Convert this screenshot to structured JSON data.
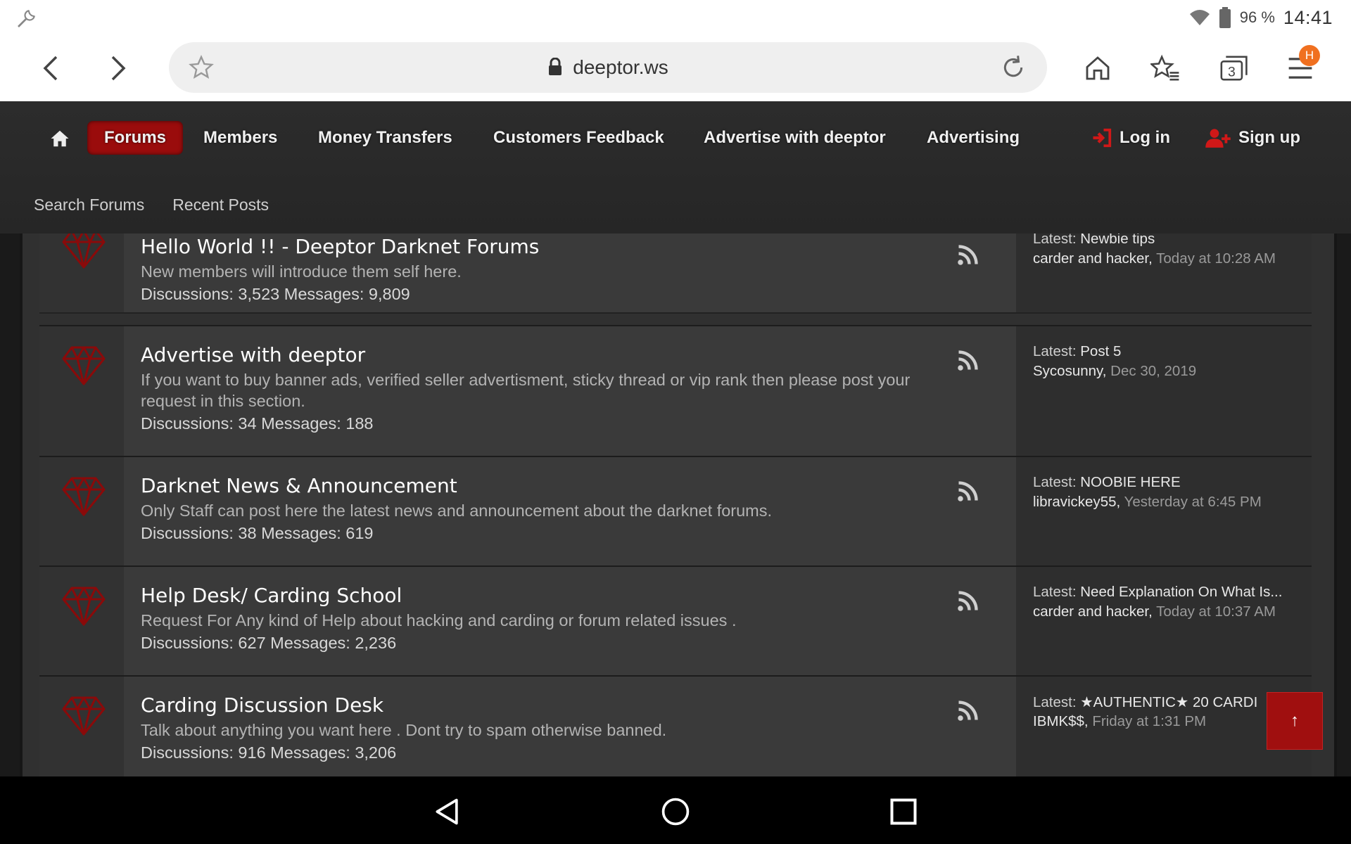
{
  "status_bar": {
    "battery": "96 %",
    "time": "14:41"
  },
  "browser": {
    "url": "deeptor.ws",
    "tab_count": "3",
    "menu_badge": "H"
  },
  "nav": {
    "items": [
      "Forums",
      "Members",
      "Money Transfers",
      "Customers Feedback",
      "Advertise with deeptor",
      "Advertising"
    ],
    "login": "Log in",
    "signup": "Sign up"
  },
  "subnav": [
    "Search Forums",
    "Recent Posts"
  ],
  "forums": [
    {
      "title": "Hello World !! - Deeptor Darknet Forums",
      "desc": "New members will introduce them self here.",
      "stats": "Discussions: 3,523 Messages: 9,809",
      "latest_label": "Latest:",
      "latest_title": "Newbie tips",
      "latest_user": "carder and hacker",
      "latest_date": "Today at 10:28 AM"
    },
    {
      "title": "Advertise with deeptor",
      "desc": "If you want to buy banner ads, verified seller advertisment, sticky thread or vip rank then please post your request in this section.",
      "stats": "Discussions: 34 Messages: 188",
      "latest_label": "Latest:",
      "latest_title": "Post 5",
      "latest_user": "Sycosunny",
      "latest_date": "Dec 30, 2019"
    },
    {
      "title": "Darknet News & Announcement",
      "desc": "Only Staff can post here the latest news and announcement about the darknet forums.",
      "stats": "Discussions: 38 Messages: 619",
      "latest_label": "Latest:",
      "latest_title": "NOOBIE HERE",
      "latest_user": "libravickey55",
      "latest_date": "Yesterday at 6:45 PM"
    },
    {
      "title": "Help Desk/ Carding School",
      "desc": "Request For Any kind of Help about hacking and carding or forum related issues .",
      "stats": "Discussions: 627 Messages: 2,236",
      "latest_label": "Latest:",
      "latest_title": "Need Explanation On What Is...",
      "latest_user": "carder and hacker",
      "latest_date": "Today at 10:37 AM"
    },
    {
      "title": "Carding Discussion Desk",
      "desc": "Talk about anything you want here . Dont try to spam otherwise banned.",
      "stats": "Discussions: 916 Messages: 3,206",
      "latest_label": "Latest:",
      "latest_title": "★AUTHENTIC★ 20 CARDI",
      "latest_user": "IBMK$$",
      "latest_date": "Friday at 1:31 PM"
    }
  ],
  "to_top": "↑",
  "colors": {
    "accent": "#9a0c0c",
    "header_bg": "#2a2a2a",
    "row_bg": "#3a3a3a"
  }
}
